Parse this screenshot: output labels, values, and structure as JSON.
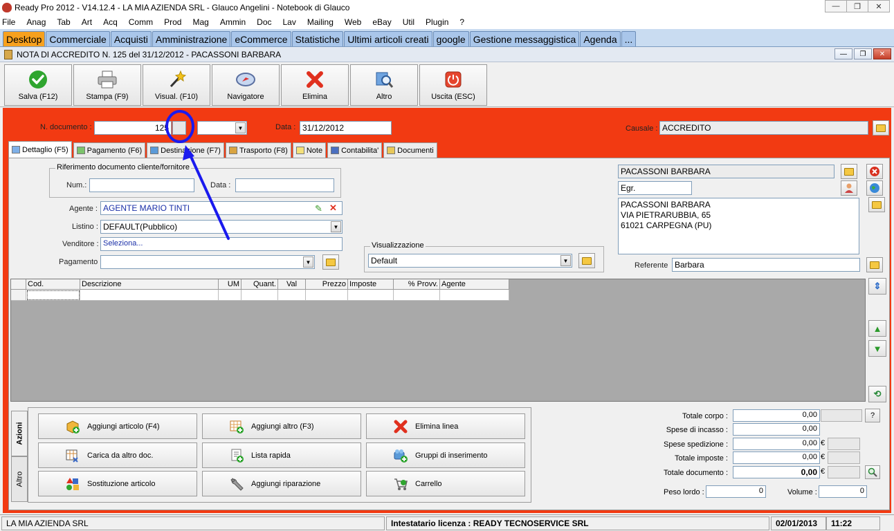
{
  "window": {
    "title": "Ready Pro 2012 - V14.12.4 - LA MIA AZIENDA SRL - Glauco Angelini - Notebook di Glauco"
  },
  "menu": [
    "File",
    "Anag",
    "Tab",
    "Art",
    "Acq",
    "Comm",
    "Prod",
    "Mag",
    "Ammin",
    "Doc",
    "Lav",
    "Mailing",
    "Web",
    "eBay",
    "Util",
    "Plugin",
    "?"
  ],
  "desk_tabs": [
    "Desktop",
    "Commerciale",
    "Acquisti",
    "Amministrazione",
    "eCommerce",
    "Statistiche",
    "Ultimi articoli creati",
    "google",
    "Gestione messaggistica",
    "Agenda",
    "..."
  ],
  "doc_window": {
    "title": "NOTA DI ACCREDITO N. 125  del 31/12/2012 - PACASSONI BARBARA"
  },
  "toolbar": [
    {
      "label": "Salva (F12)",
      "icon": "check-icon"
    },
    {
      "label": "Stampa (F9)",
      "icon": "printer-icon"
    },
    {
      "label": "Visual. (F10)",
      "icon": "magic-wand-icon"
    },
    {
      "label": "Navigatore",
      "icon": "compass-icon"
    },
    {
      "label": "Elimina",
      "icon": "delete-icon"
    },
    {
      "label": "Altro",
      "icon": "search-icon"
    },
    {
      "label": "Uscita (ESC)",
      "icon": "power-icon"
    }
  ],
  "header": {
    "ndoc_label": "N. documento :",
    "ndoc_value": "125",
    "data_label": "Data :",
    "data_value": "31/12/2012",
    "causale_label": "Causale :",
    "causale_value": "ACCREDITO"
  },
  "doc_tabs": [
    "Dettaglio (F5)",
    "Pagamento (F6)",
    "Destinazione (F7)",
    "Trasporto (F8)",
    "Note",
    "Contabilita'",
    "Documenti"
  ],
  "riferimento": {
    "title": "Riferimento documento cliente/fornitore",
    "num_label": "Num.:",
    "data_label": "Data :"
  },
  "form": {
    "agente_label": "Agente :",
    "agente_value": "AGENTE MARIO TINTI",
    "listino_label": "Listino :",
    "listino_value": "DEFAULT(Pubblico)",
    "venditore_label": "Venditore :",
    "venditore_value": "Seleziona...",
    "pagamento_label": "Pagamento :",
    "visualizzazione_label": "Visualizzazione",
    "visualizzazione_value": "Default"
  },
  "cliente": {
    "name": "PACASSONI BARBARA",
    "title": "Egr.",
    "address_lines": [
      "PACASSONI BARBARA",
      "VIA PIETRARUBBIA, 65",
      "61021 CARPEGNA (PU)"
    ],
    "referente_label": "Referente",
    "referente_value": "Barbara"
  },
  "grid": {
    "columns": [
      "Cod.",
      "Descrizione",
      "UM",
      "Quant.",
      "Val",
      "Prezzo",
      "Imposte",
      "% Provv.",
      "Agente"
    ]
  },
  "actions": {
    "vtabs": [
      "Azioni",
      "Altro"
    ],
    "buttons": [
      {
        "label": "Aggiungi articolo (F4)",
        "icon": "box-add-icon"
      },
      {
        "label": "Aggiungi altro (F3)",
        "icon": "grid-add-icon"
      },
      {
        "label": "Elimina linea",
        "icon": "delete-icon"
      },
      {
        "label": "Carica da altro doc.",
        "icon": "document-load-icon"
      },
      {
        "label": "Lista rapida",
        "icon": "list-icon"
      },
      {
        "label": "Gruppi di inserimento",
        "icon": "group-add-icon"
      },
      {
        "label": "Sostituzione articolo",
        "icon": "replace-icon"
      },
      {
        "label": "Aggiungi riparazione",
        "icon": "wrench-icon"
      },
      {
        "label": "Carrello",
        "icon": "cart-icon"
      }
    ]
  },
  "totals": {
    "corpo_label": "Totale corpo :",
    "corpo": "0,00",
    "incasso_label": "Spese di incasso :",
    "incasso": "0,00",
    "spedizione_label": "Spese spedizione :",
    "spedizione": "0,00",
    "imposte_label": "Totale imposte :",
    "imposte": "0,00",
    "documento_label": "Totale documento :",
    "documento": "0,00",
    "currency": "€",
    "help": "?",
    "peso_label": "Peso lordo :",
    "peso": "0",
    "volume_label": "Volume :",
    "volume": "0"
  },
  "status": {
    "company": "LA MIA AZIENDA SRL",
    "license": "Intestatario licenza : READY TECNOSERVICE SRL",
    "date": "02/01/2013",
    "time": "11:22"
  },
  "colors": {
    "main_bg": "#f23a12",
    "active_tab": "#f7a11e",
    "annotation": "#1a1aee"
  }
}
